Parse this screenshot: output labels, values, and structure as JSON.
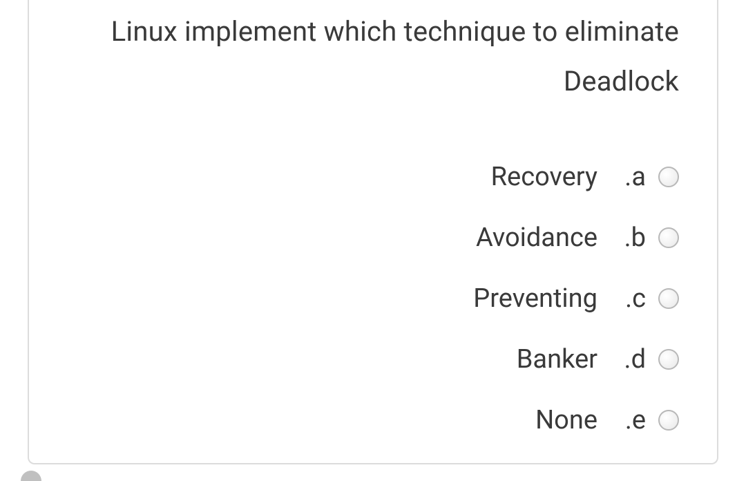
{
  "question": {
    "text": "Linux implement which technique to eliminate Deadlock"
  },
  "options": [
    {
      "letter": ".a",
      "label": "Recovery"
    },
    {
      "letter": ".b",
      "label": "Avoidance"
    },
    {
      "letter": ".c",
      "label": "Preventing"
    },
    {
      "letter": ".d",
      "label": "Banker"
    },
    {
      "letter": ".e",
      "label": "None"
    }
  ]
}
